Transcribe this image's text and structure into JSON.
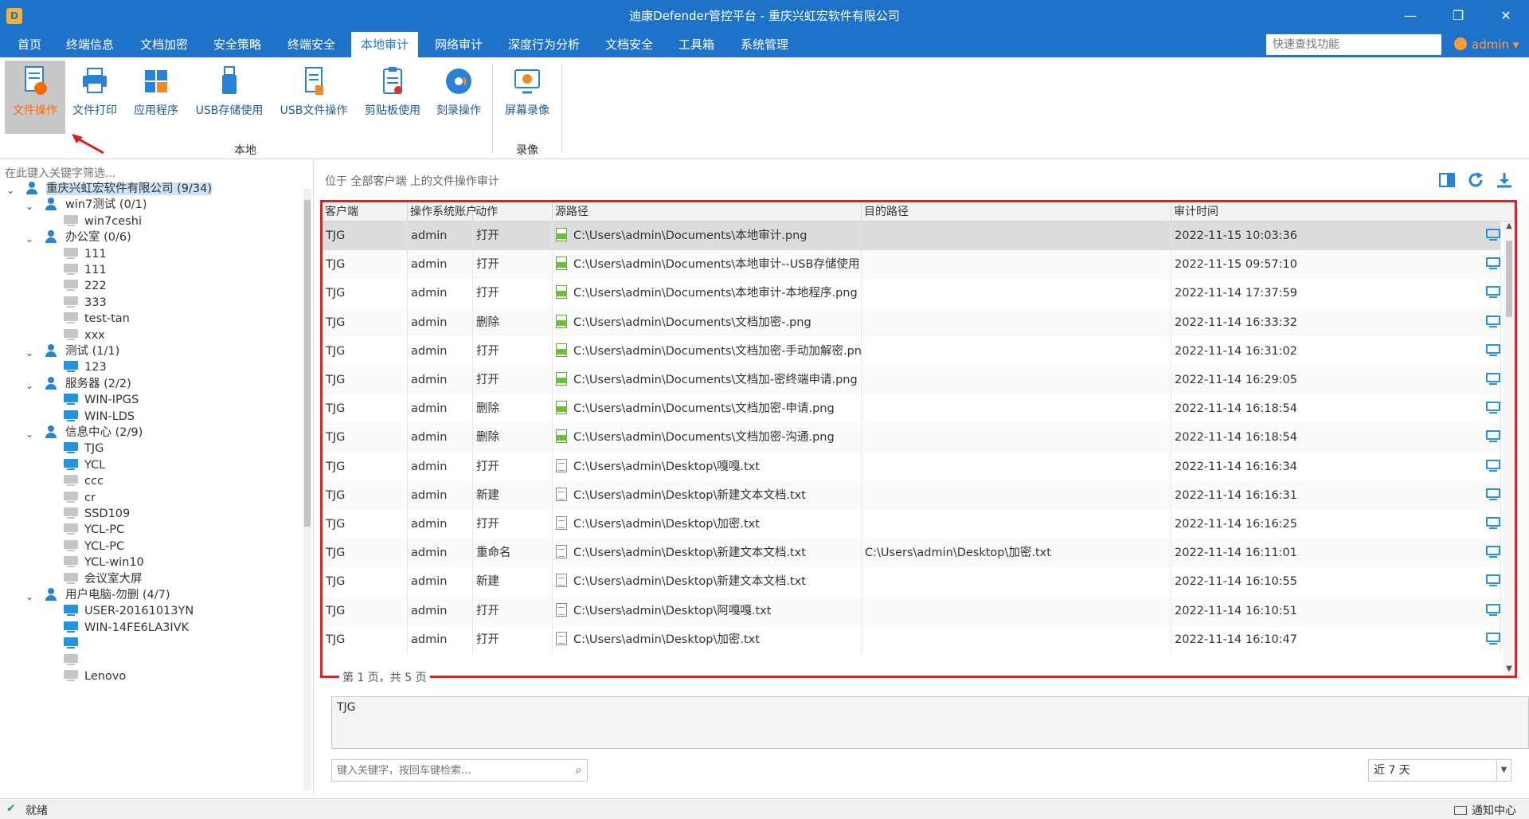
{
  "window": {
    "title": "迪康Defender管控平台 - 重庆兴虹宏软件有限公司",
    "minimize": "—",
    "restore": "❐",
    "close": "✕"
  },
  "menu": {
    "items": [
      "首页",
      "终端信息",
      "文档加密",
      "安全策略",
      "终端安全",
      "本地审计",
      "网络审计",
      "深度行为分析",
      "文档安全",
      "工具箱",
      "系统管理"
    ],
    "active_index": 5,
    "quick_search_placeholder": "快速查找功能",
    "user": "admin",
    "user_caret": "▾"
  },
  "ribbon": {
    "buttons": [
      {
        "label": "文件操作",
        "icon": "file-operation-icon",
        "active": true
      },
      {
        "label": "文件打印",
        "icon": "printer-icon"
      },
      {
        "label": "应用程序",
        "icon": "app-grid-icon"
      },
      {
        "label": "USB存储使用",
        "icon": "usb-drive-icon"
      },
      {
        "label": "USB文件操作",
        "icon": "usb-file-icon"
      },
      {
        "label": "剪贴板使用",
        "icon": "clipboard-icon"
      },
      {
        "label": "刻录操作",
        "icon": "disc-burn-icon"
      },
      {
        "label": "屏幕录像",
        "icon": "screen-record-icon"
      }
    ],
    "groups": [
      "本地",
      "录像"
    ]
  },
  "tree": {
    "filter_placeholder": "在此键入关键字筛选...",
    "items": [
      {
        "label": "重庆兴虹宏软件有限公司 (9/34)",
        "type": "group",
        "level": 0,
        "selected": true
      },
      {
        "label": "win7测试 (0/1)",
        "type": "group",
        "level": 1
      },
      {
        "label": "win7ceshi",
        "type": "pc",
        "level": 2,
        "status": "offline"
      },
      {
        "label": "办公室 (0/6)",
        "type": "group",
        "level": 1
      },
      {
        "label": "111",
        "type": "pc",
        "level": 2,
        "status": "offline"
      },
      {
        "label": "111",
        "type": "pc",
        "level": 2,
        "status": "offline"
      },
      {
        "label": "222",
        "type": "pc",
        "level": 2,
        "status": "offline"
      },
      {
        "label": "333",
        "type": "pc",
        "level": 2,
        "status": "offline"
      },
      {
        "label": "test-tan",
        "type": "pc",
        "level": 2,
        "status": "offline"
      },
      {
        "label": "xxx",
        "type": "pc",
        "level": 2,
        "status": "offline"
      },
      {
        "label": "测试 (1/1)",
        "type": "group",
        "level": 1
      },
      {
        "label": "123",
        "type": "pc",
        "level": 2,
        "status": "online"
      },
      {
        "label": "服务器 (2/2)",
        "type": "group",
        "level": 1
      },
      {
        "label": "WIN-IPGS",
        "type": "pc",
        "level": 2,
        "status": "online"
      },
      {
        "label": "WIN-LDS",
        "type": "pc",
        "level": 2,
        "status": "online"
      },
      {
        "label": "信息中心 (2/9)",
        "type": "group",
        "level": 1
      },
      {
        "label": "TJG",
        "type": "pc",
        "level": 2,
        "status": "online"
      },
      {
        "label": "YCL",
        "type": "pc",
        "level": 2,
        "status": "online"
      },
      {
        "label": "ccc",
        "type": "pc",
        "level": 2,
        "status": "offline"
      },
      {
        "label": "cr",
        "type": "pc",
        "level": 2,
        "status": "offline"
      },
      {
        "label": "SSD109",
        "type": "pc",
        "level": 2,
        "status": "offline"
      },
      {
        "label": "YCL-PC",
        "type": "pc",
        "level": 2,
        "status": "offline"
      },
      {
        "label": "YCL-PC",
        "type": "pc",
        "level": 2,
        "status": "offline"
      },
      {
        "label": "YCL-win10",
        "type": "pc",
        "level": 2,
        "status": "offline"
      },
      {
        "label": "会议室大屏",
        "type": "pc",
        "level": 2,
        "status": "offline"
      },
      {
        "label": "用户电脑-勿删 (4/7)",
        "type": "group",
        "level": 1
      },
      {
        "label": "USER-20161013YN",
        "type": "pc",
        "level": 2,
        "status": "online"
      },
      {
        "label": "WIN-14FE6LA3IVK",
        "type": "pc",
        "level": 2,
        "status": "online"
      },
      {
        "label": "",
        "type": "pc",
        "level": 2,
        "status": "online"
      },
      {
        "label": "",
        "type": "pc",
        "level": 2,
        "status": "offline"
      },
      {
        "label": "Lenovo",
        "type": "pc",
        "level": 2,
        "status": "offline"
      }
    ]
  },
  "audit": {
    "location": "位于 全部客户端 上的文件操作审计",
    "toolbar_icons": [
      "columns-icon",
      "refresh-icon",
      "download-icon"
    ],
    "columns": [
      "客户端",
      "操作系统账户",
      "动作",
      "源路径",
      "目的路径",
      "审计时间"
    ],
    "rows": [
      {
        "client": "TJG",
        "account": "admin",
        "action": "打开",
        "source": "C:\\Users\\admin\\Documents\\本地审计.png",
        "dest": "",
        "time": "2022-11-15 10:03:36",
        "ftype": "png"
      },
      {
        "client": "TJG",
        "account": "admin",
        "action": "打开",
        "source": "C:\\Users\\admin\\Documents\\本地审计--USB存储使用.png",
        "dest": "",
        "time": "2022-11-15 09:57:10",
        "ftype": "png"
      },
      {
        "client": "TJG",
        "account": "admin",
        "action": "打开",
        "source": "C:\\Users\\admin\\Documents\\本地审计-本地程序.png",
        "dest": "",
        "time": "2022-11-14 17:37:59",
        "ftype": "png"
      },
      {
        "client": "TJG",
        "account": "admin",
        "action": "删除",
        "source": "C:\\Users\\admin\\Documents\\文档加密-.png",
        "dest": "",
        "time": "2022-11-14 16:33:32",
        "ftype": "png"
      },
      {
        "client": "TJG",
        "account": "admin",
        "action": "打开",
        "source": "C:\\Users\\admin\\Documents\\文档加密-手动加解密.png",
        "dest": "",
        "time": "2022-11-14 16:31:02",
        "ftype": "png"
      },
      {
        "client": "TJG",
        "account": "admin",
        "action": "打开",
        "source": "C:\\Users\\admin\\Documents\\文档加-密终端申请.png",
        "dest": "",
        "time": "2022-11-14 16:29:05",
        "ftype": "png"
      },
      {
        "client": "TJG",
        "account": "admin",
        "action": "删除",
        "source": "C:\\Users\\admin\\Documents\\文档加密-申请.png",
        "dest": "",
        "time": "2022-11-14 16:18:54",
        "ftype": "png"
      },
      {
        "client": "TJG",
        "account": "admin",
        "action": "删除",
        "source": "C:\\Users\\admin\\Documents\\文档加密-沟通.png",
        "dest": "",
        "time": "2022-11-14 16:18:54",
        "ftype": "png"
      },
      {
        "client": "TJG",
        "account": "admin",
        "action": "打开",
        "source": "C:\\Users\\admin\\Desktop\\嘎嘎.txt",
        "dest": "",
        "time": "2022-11-14 16:16:34",
        "ftype": "txt"
      },
      {
        "client": "TJG",
        "account": "admin",
        "action": "新建",
        "source": "C:\\Users\\admin\\Desktop\\新建文本文档.txt",
        "dest": "",
        "time": "2022-11-14 16:16:31",
        "ftype": "txt"
      },
      {
        "client": "TJG",
        "account": "admin",
        "action": "打开",
        "source": "C:\\Users\\admin\\Desktop\\加密.txt",
        "dest": "",
        "time": "2022-11-14 16:16:25",
        "ftype": "txt"
      },
      {
        "client": "TJG",
        "account": "admin",
        "action": "重命名",
        "source": "C:\\Users\\admin\\Desktop\\新建文本文档.txt",
        "dest": "C:\\Users\\admin\\Desktop\\加密.txt",
        "time": "2022-11-14 16:11:01",
        "ftype": "txt"
      },
      {
        "client": "TJG",
        "account": "admin",
        "action": "新建",
        "source": "C:\\Users\\admin\\Desktop\\新建文本文档.txt",
        "dest": "",
        "time": "2022-11-14 16:10:55",
        "ftype": "txt"
      },
      {
        "client": "TJG",
        "account": "admin",
        "action": "打开",
        "source": "C:\\Users\\admin\\Desktop\\阿嘎嘎.txt",
        "dest": "",
        "time": "2022-11-14 16:10:51",
        "ftype": "txt"
      },
      {
        "client": "TJG",
        "account": "admin",
        "action": "打开",
        "source": "C:\\Users\\admin\\Desktop\\加密.txt",
        "dest": "",
        "time": "2022-11-14 16:10:47",
        "ftype": "txt"
      }
    ],
    "pager": "第 1 页，共 5 页",
    "detail_text": "TJG",
    "search_placeholder": "键入关键字，按回车键检索...",
    "range": "近 7 天"
  },
  "status": {
    "text": "就绪",
    "notify": "通知中心"
  },
  "colors": {
    "brand": "#1e73c8",
    "highlight_border": "#e02020",
    "active_ribbon_text": "#ff6a00",
    "online": "#2493e0"
  }
}
